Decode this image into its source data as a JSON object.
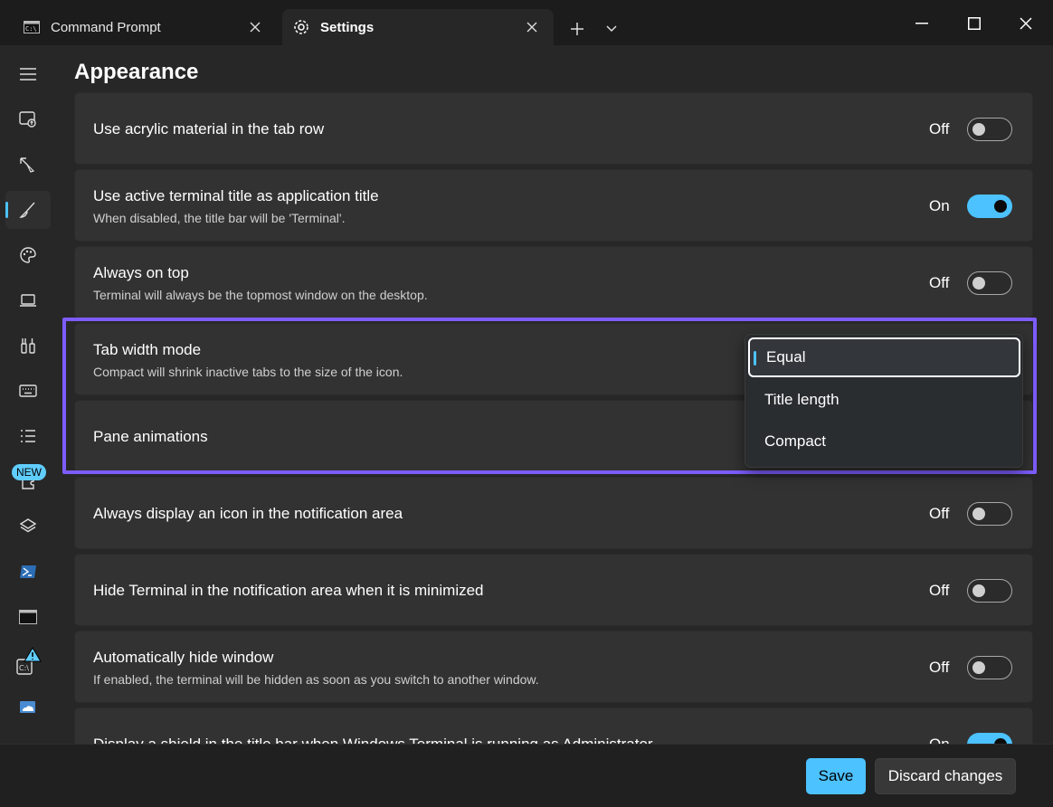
{
  "tabs": [
    {
      "label": "Command Prompt",
      "icon": "cmd-icon"
    },
    {
      "label": "Settings",
      "icon": "gear-icon"
    }
  ],
  "page": {
    "title": "Appearance"
  },
  "nav": {
    "new_badge": "NEW"
  },
  "settings": [
    {
      "title": "Use acrylic material in the tab row",
      "desc": "",
      "state": "Off"
    },
    {
      "title": "Use active terminal title as application title",
      "desc": "When disabled, the title bar will be 'Terminal'.",
      "state": "On"
    },
    {
      "title": "Always on top",
      "desc": "Terminal will always be the topmost window on the desktop.",
      "state": "Off"
    },
    {
      "title": "Tab width mode",
      "desc": "Compact will shrink inactive tabs to the size of the icon.",
      "state": ""
    },
    {
      "title": "Pane animations",
      "desc": "",
      "state": ""
    },
    {
      "title": "Always display an icon in the notification area",
      "desc": "",
      "state": "Off"
    },
    {
      "title": "Hide Terminal in the notification area when it is minimized",
      "desc": "",
      "state": "Off"
    },
    {
      "title": "Automatically hide window",
      "desc": "If enabled, the terminal will be hidden as soon as you switch to another window.",
      "state": "Off"
    },
    {
      "title": "Display a shield in the title bar when Windows Terminal is running as Administrator",
      "desc": "",
      "state": "On"
    }
  ],
  "dropdown": {
    "options": [
      "Equal",
      "Title length",
      "Compact"
    ],
    "selected": "Equal"
  },
  "footer": {
    "save_label": "Save",
    "discard_label": "Discard changes"
  },
  "colors": {
    "accent": "#4cc2ff",
    "highlight": "#7d5cff"
  }
}
